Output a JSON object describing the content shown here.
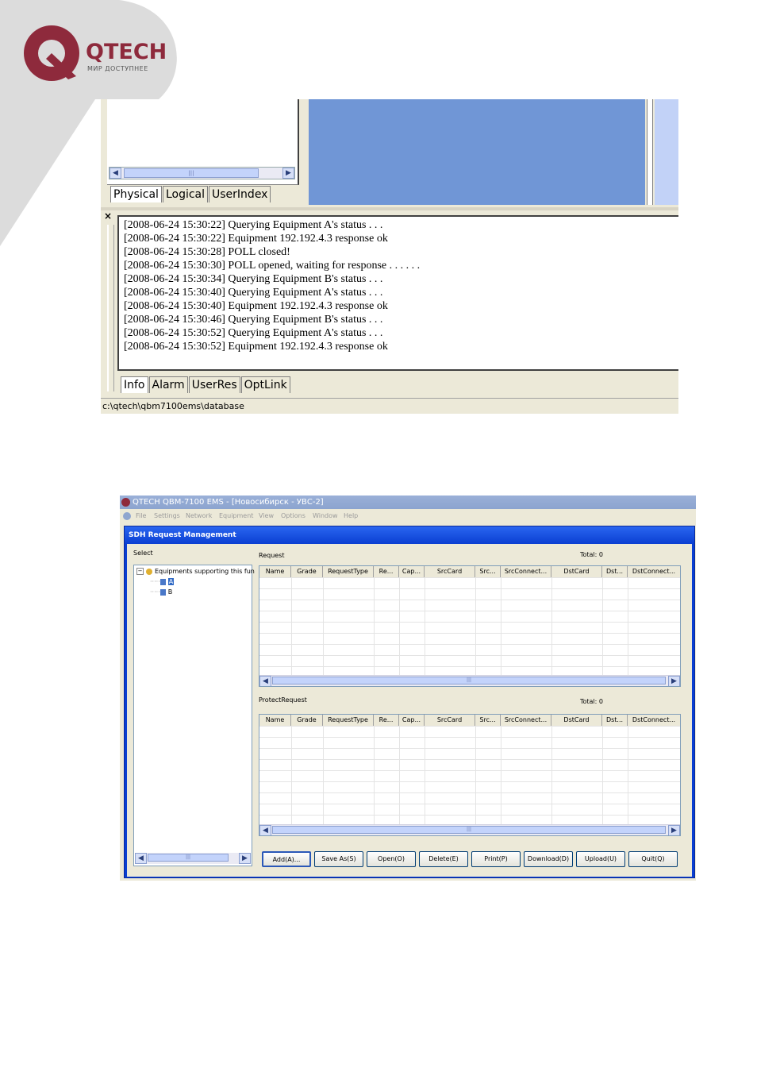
{
  "logo": {
    "brand": "QTECH",
    "tagline": "МИР ДОСТУПНЕЕ"
  },
  "shot1": {
    "tree_tabs": [
      "Physical",
      "Logical",
      "UserIndex"
    ],
    "close_glyph": "×",
    "log_lines": [
      "[2008-06-24 15:30:22] Querying Equipment A's status . . .",
      "[2008-06-24 15:30:22] Equipment 192.192.4.3 response ok",
      "[2008-06-24 15:30:28] POLL closed!",
      "[2008-06-24 15:30:30] POLL opened, waiting for response . . . . . .",
      "[2008-06-24 15:30:34] Querying Equipment B's status . . .",
      "[2008-06-24 15:30:40] Querying Equipment A's status . . .",
      "[2008-06-24 15:30:40] Equipment 192.192.4.3 response ok",
      "[2008-06-24 15:30:46] Querying Equipment B's status . . .",
      "[2008-06-24 15:30:52] Querying Equipment A's status . . .",
      "[2008-06-24 15:30:52] Equipment 192.192.4.3 response ok"
    ],
    "bottom_tabs": [
      "Info",
      "Alarm",
      "UserRes",
      "OptLink"
    ],
    "status_path": "c:\\qtech\\qbm7100ems\\database"
  },
  "shot2": {
    "app_title": "QTECH QBM-7100 EMS - [Новосибирск - УВС-2]",
    "menu": [
      "File",
      "Settings",
      "Network",
      "Equipment",
      "View",
      "Options",
      "Window",
      "Help"
    ],
    "dialog_title": "SDH Request Management",
    "select_label": "Select",
    "tree": {
      "root": "Equipments supporting this fun",
      "children": [
        "A",
        "B"
      ]
    },
    "request": {
      "label": "Request",
      "total": "Total: 0"
    },
    "protect": {
      "label": "ProtectRequest",
      "total": "Total: 0"
    },
    "columns": [
      "Name",
      "Grade",
      "RequestType",
      "Re...",
      "Cap...",
      "SrcCard",
      "Src...",
      "SrcConnect...",
      "DstCard",
      "Dst...",
      "DstConnect..."
    ],
    "buttons": [
      "Add(A)...",
      "Save As(S)",
      "Open(O)",
      "Delete(E)",
      "Print(P)",
      "Download(D)",
      "Upload(U)",
      "Quit(Q)"
    ]
  },
  "colors": {
    "brand": "#8e2a3c",
    "blue_panel": "#7096d6",
    "dialog_blue": "#0a3fd2"
  }
}
